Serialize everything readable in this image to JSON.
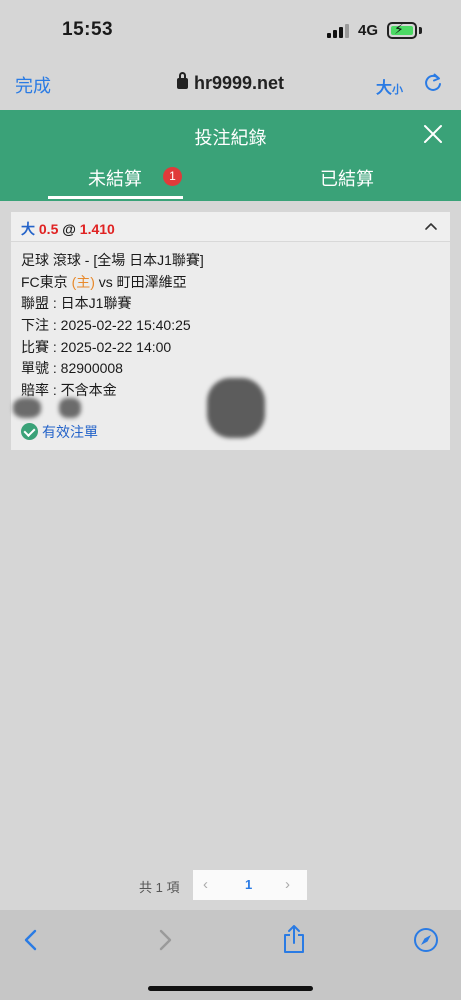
{
  "status_bar": {
    "time": "15:53",
    "network": "4G"
  },
  "browser": {
    "done_label": "完成",
    "url": "hr9999.net",
    "textsize_big": "大",
    "textsize_small": "小"
  },
  "header": {
    "title": "投注紀錄",
    "tabs": [
      {
        "label": "未結算",
        "badge": "1",
        "active": true
      },
      {
        "label": "已結算",
        "active": false
      }
    ]
  },
  "bet": {
    "selection": "大",
    "line": "0.5",
    "at": "@",
    "odds": "1.410",
    "sport_line": "足球 滾球 - [全場 日本J1聯賽]",
    "home_team": "FC東京",
    "home_tag": "(主)",
    "vs_away": "vs 町田澤維亞",
    "league": "聯盟 : 日本J1聯賽",
    "bet_time": "下注 : 2025-02-22 15:40:25",
    "match_time": "比賽 : 2025-02-22 14:00",
    "ticket": "單號 : 82900008",
    "odds_type": "賠率 : 不含本金",
    "status": "有效注單"
  },
  "pagination": {
    "total": "共 1 項",
    "prev": "‹",
    "page": "1",
    "next": "›"
  },
  "colors": {
    "header_green": "#3aa278",
    "ios_blue": "#2a7be4",
    "odds_red": "#e02222",
    "badge_red": "#e03a3a"
  }
}
